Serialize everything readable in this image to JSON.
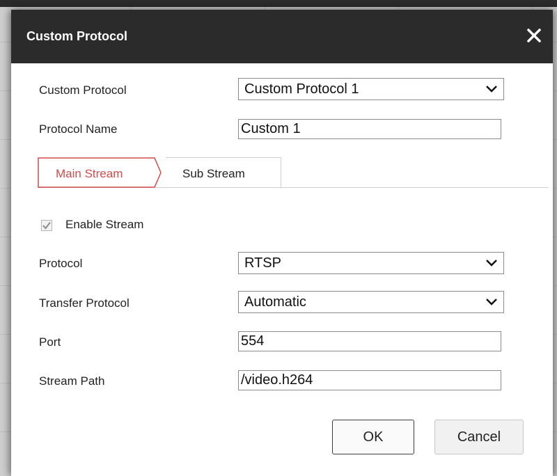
{
  "dialog": {
    "title": "Custom Protocol",
    "close_icon": "close-icon"
  },
  "form": {
    "custom_protocol": {
      "label": "Custom Protocol",
      "value": "Custom Protocol 1"
    },
    "protocol_name": {
      "label": "Protocol Name",
      "value": "Custom 1"
    }
  },
  "tabs": [
    {
      "label": "Main Stream",
      "active": true
    },
    {
      "label": "Sub Stream",
      "active": false
    }
  ],
  "stream": {
    "enable": {
      "label": "Enable Stream",
      "checked": true
    },
    "protocol": {
      "label": "Protocol",
      "value": "RTSP"
    },
    "transfer_protocol": {
      "label": "Transfer Protocol",
      "value": "Automatic"
    },
    "port": {
      "label": "Port",
      "value": "554"
    },
    "stream_path": {
      "label": "Stream Path",
      "value": "/video.h264"
    }
  },
  "buttons": {
    "ok": "OK",
    "cancel": "Cancel"
  },
  "colors": {
    "titlebar": "#2b2b2b",
    "active_tab": "#d24b4b"
  }
}
